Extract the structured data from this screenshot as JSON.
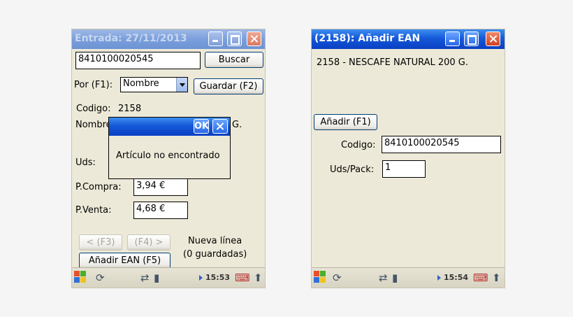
{
  "left_window": {
    "title": "Entrada: 27/11/2013",
    "barcode_value": "8410100020545",
    "search_button": "Buscar",
    "search_by_label": "Por (F1):",
    "search_by_value": "Nombre",
    "save_button": "Guardar (F2)",
    "code_label": "Codigo:",
    "code_value": "2158",
    "name_label_partial": "Nombre",
    "name_value_partial": "G.",
    "units_label": "Uds:",
    "purchase_price_label": "P.Compra:",
    "purchase_price_value": "3,94 €",
    "sale_price_label": "P.Venta:",
    "sale_price_value": "4,68 €",
    "prev_button": "< (F3)",
    "next_button": "(F4) >",
    "new_line_label": "Nueva línea",
    "saved_count_label": "(0 guardadas)",
    "add_ean_button": "Añadir EAN (F5)",
    "dialog": {
      "ok_label": "OK",
      "message": "Artículo no encontrado"
    },
    "clock": "15:53"
  },
  "right_window": {
    "title": "(2158): Añadir EAN",
    "product_line": "2158 - NESCAFE NATURAL 200 G.",
    "add_button": "Añadir (F1)",
    "code_label": "Codigo:",
    "code_value": "8410100020545",
    "units_pack_label": "Uds/Pack:",
    "units_pack_value": "1",
    "clock": "15:54"
  }
}
